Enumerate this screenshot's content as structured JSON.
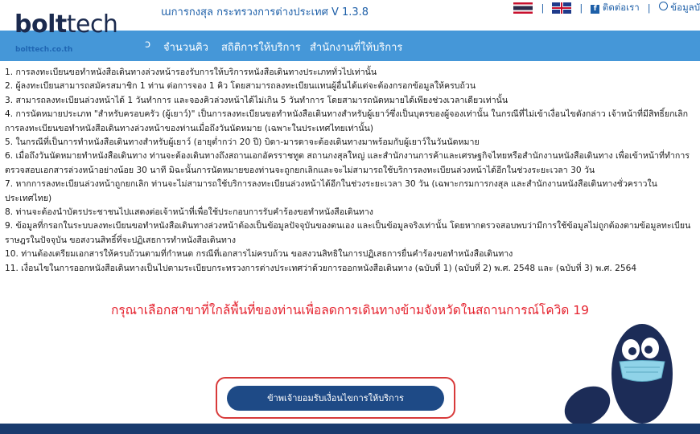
{
  "header": {
    "app_title": "ɯการกงสุล กระทรวงการต่างประเทศ V 1.3.8",
    "logo_bold": "bolt",
    "logo_light": "tech",
    "logo_sub": "bolttech.co.th",
    "contact_label": "ติดต่อเรา",
    "account_label": "ข้อมูลบั"
  },
  "nav": {
    "items": [
      {
        "label": "ɔ"
      },
      {
        "label": "จำนวนคิว"
      },
      {
        "label": "สถิติการให้บริการ"
      },
      {
        "label": "สำนักงานที่ให้บริการ"
      }
    ]
  },
  "terms": [
    "1. การลงทะเบียนขอทำหนังสือเดินทางล่วงหน้ารองรับการให้บริการหนังสือเดินทางประเภททั่วไปเท่านั้น",
    "2. ผู้ลงทะเบียนสามารถสมัครสมาชิก 1 ท่าน ต่อการจอง 1 คิว โดยสามารถลงทะเบียนแทนผู้อื่นได้แต่จะต้องกรอกข้อมูลให้ครบถ้วน",
    "3. สามารถลงทะเบียนล่วงหน้าได้ 1 วันทำการ และจองคิวล่วงหน้าได้ไม่เกิน 5 วันทำการ โดยสามารถนัดหมายได้เพียงช่วงเวลาเดียวเท่านั้น",
    "4. การนัดหมายประเภท \"สำหรับครอบครัว (ผู้เยาว์)\" เป็นการลงทะเบียนขอทำหนังสือเดินทางสำหรับผู้เยาว์ซึ่งเป็นบุตรของผู้จองเท่านั้น ในกรณีที่ไม่เข้าเงื่อนไขดังกล่าว เจ้าหน้าที่มีสิทธิ์ยกเลิกการลงทะเบียนขอทำหนังสือเดินทางล่วงหน้าของท่านเมื่อถึงวันนัดหมาย (เฉพาะในประเทศไทยเท่านั้น)",
    "5. ในกรณีที่เป็นการทำหนังสือเดินทางสำหรับผู้เยาว์ (อายุต่ำกว่า 20 ปี) บิดา-มารดาจะต้องเดินทางมาพร้อมกับผู้เยาว์ในวันนัดหมาย",
    "6. เมื่อถึงวันนัดหมายทำหนังสือเดินทาง ท่านจะต้องเดินทางถึงสถานเอกอัครราชทูต สถานกงสุลใหญ่ และสำนักงานการค้าและเศรษฐกิจไทยหรือสำนักงานหนังสือเดินทาง เพื่อเข้าหน้าที่ทำการตรวจสอบเอกสารล่วงหน้าอย่างน้อย 30 นาที มิฉะนั้นการนัดหมายของท่านจะถูกยกเลิกและจะไม่สามารถใช้บริการลงทะเบียนล่วงหน้าได้อีกในช่วงระยะเวลา 30 วัน",
    "7. หากการลงทะเบียนล่วงหน้าถูกยกเลิก ท่านจะไม่สามารถใช้บริการลงทะเบียนล่วงหน้าได้อีกในช่วงระยะเวลา 30 วัน (เฉพาะกรมการกงสุล และสำนักงานหนังสือเดินทางชั่วคราวในประเทศไทย)",
    "8. ท่านจะต้องนำบัตรประชาชนไปแสดงต่อเจ้าหน้าที่เพื่อใช้ประกอบการรับคำร้องขอทำหนังสือเดินทาง",
    "9. ข้อมูลที่กรอกในระบบลงทะเบียนขอทำหนังสือเดินทางล่วงหน้าต้องเป็นข้อมูลปัจจุบันของตนเอง และเป็นข้อมูลจริงเท่านั้น โดยหากตรวจสอบพบว่ามีการใช้ข้อมูลไม่ถูกต้องตามข้อมูลทะเบียนราษฎรในปัจจุบัน ขอสงวนสิทธิ์ที่จะปฏิเสธการทำหนังสือเดินทาง",
    "10. ท่านต้องเตรียมเอกสารให้ครบถ้วนตามที่กำหนด กรณีที่เอกสารไม่ครบถ้วน ขอสงวนสิทธิในการปฏิเสธการยื่นคำร้องขอทำหนังสือเดินทาง",
    "11. เงื่อนไขในการออกหนังสือเดินทางเป็นไปตามระเบียบกระทรวงการต่างประเทศว่าด้วยการออกหนังสือเดินทาง (ฉบับที่ 1) (ฉบับที่ 2) พ.ศ. 2548 และ (ฉบับที่ 3) พ.ศ. 2564"
  ],
  "notice": "กรุณาเลือกสาขาที่ใกล้พื้นที่ของท่านเพื่อลดการเดินทางข้ามจังหวัดในสถานการณ์โควิด 19",
  "accept_button": "ข้าพเจ้ายอมรับเงื่อนไขการให้บริการ",
  "colors": {
    "nav_bg": "#4597d8",
    "button_bg": "#1e4a86",
    "notice": "#e5232f",
    "footer": "#1a3b6e"
  }
}
